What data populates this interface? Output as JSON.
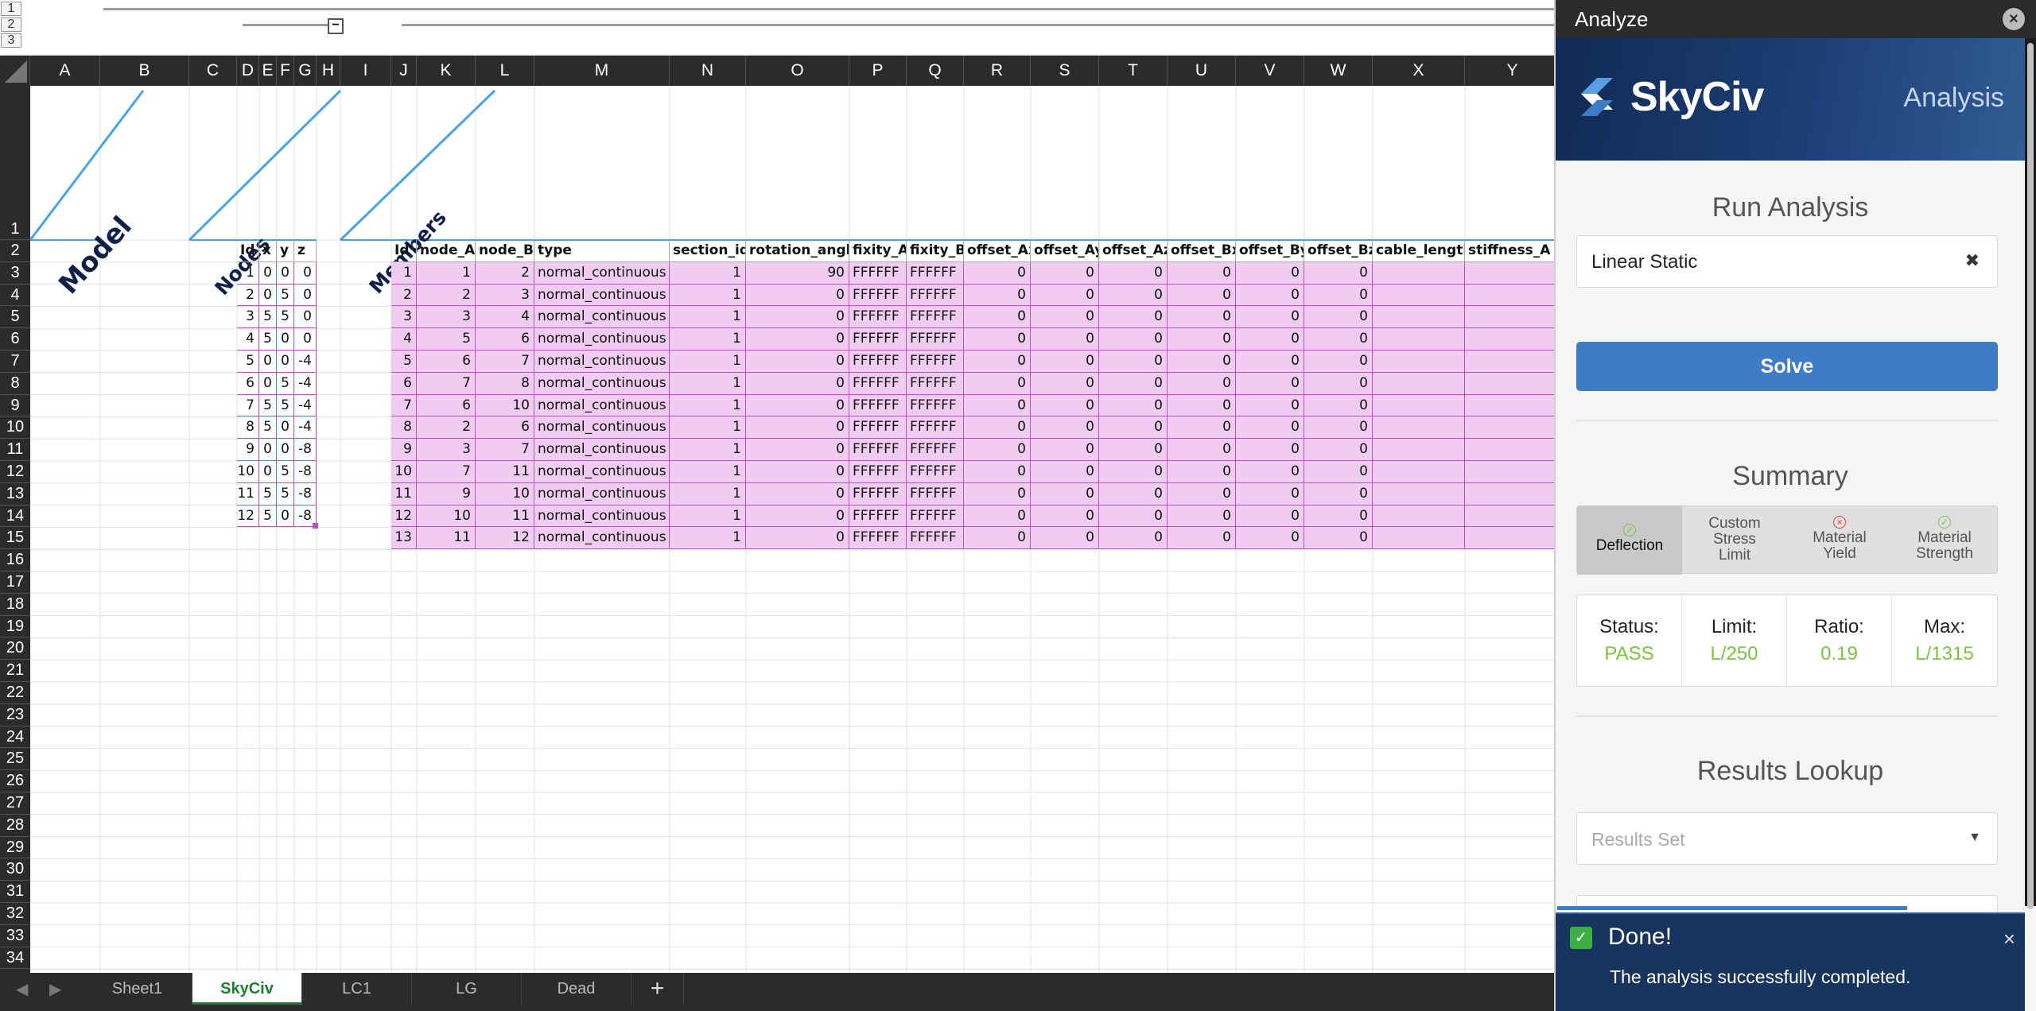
{
  "outline": {
    "levels": [
      "1",
      "2",
      "3"
    ],
    "collapse_symbol": "−"
  },
  "columns": [
    "A",
    "B",
    "C",
    "D",
    "E",
    "F",
    "G",
    "H",
    "I",
    "J",
    "K",
    "L",
    "M",
    "N",
    "O",
    "P",
    "Q",
    "R",
    "S",
    "T",
    "U",
    "V",
    "W",
    "X",
    "Y"
  ],
  "rows": [
    "1",
    "2",
    "3",
    "4",
    "5",
    "6",
    "7",
    "8",
    "9",
    "10",
    "11",
    "12",
    "13",
    "14",
    "15",
    "16",
    "17",
    "18",
    "19",
    "20",
    "21",
    "22",
    "23",
    "24",
    "25",
    "26",
    "27",
    "28",
    "29",
    "30",
    "31",
    "32",
    "33",
    "34"
  ],
  "section_titles": {
    "model": "Model",
    "nodes": "Nodes",
    "members": "Members"
  },
  "nodes": {
    "headers": [
      "Id",
      "x",
      "y",
      "z"
    ],
    "rows": [
      [
        "1",
        "0",
        "0",
        "0"
      ],
      [
        "2",
        "0",
        "5",
        "0"
      ],
      [
        "3",
        "5",
        "5",
        "0"
      ],
      [
        "4",
        "5",
        "0",
        "0"
      ],
      [
        "5",
        "0",
        "0",
        "-4"
      ],
      [
        "6",
        "0",
        "5",
        "-4"
      ],
      [
        "7",
        "5",
        "5",
        "-4"
      ],
      [
        "8",
        "5",
        "0",
        "-4"
      ],
      [
        "9",
        "0",
        "0",
        "-8"
      ],
      [
        "10",
        "0",
        "5",
        "-8"
      ],
      [
        "11",
        "5",
        "5",
        "-8"
      ],
      [
        "12",
        "5",
        "0",
        "-8"
      ]
    ]
  },
  "members": {
    "headers": [
      "Id",
      "node_A",
      "node_B",
      "type",
      "section_id",
      "rotation_angle",
      "fixity_A",
      "fixity_B",
      "offset_Ax",
      "offset_Ay",
      "offset_Az",
      "offset_Bx",
      "offset_By",
      "offset_Bz",
      "cable_length",
      "stiffness_A"
    ],
    "rows": [
      [
        "1",
        "1",
        "2",
        "normal_continuous",
        "1",
        "90",
        "FFFFFF",
        "FFFFFF",
        "0",
        "0",
        "0",
        "0",
        "0",
        "0",
        "",
        ""
      ],
      [
        "2",
        "2",
        "3",
        "normal_continuous",
        "1",
        "0",
        "FFFFFF",
        "FFFFFF",
        "0",
        "0",
        "0",
        "0",
        "0",
        "0",
        "",
        ""
      ],
      [
        "3",
        "3",
        "4",
        "normal_continuous",
        "1",
        "0",
        "FFFFFF",
        "FFFFFF",
        "0",
        "0",
        "0",
        "0",
        "0",
        "0",
        "",
        ""
      ],
      [
        "4",
        "5",
        "6",
        "normal_continuous",
        "1",
        "0",
        "FFFFFF",
        "FFFFFF",
        "0",
        "0",
        "0",
        "0",
        "0",
        "0",
        "",
        ""
      ],
      [
        "5",
        "6",
        "7",
        "normal_continuous",
        "1",
        "0",
        "FFFFFF",
        "FFFFFF",
        "0",
        "0",
        "0",
        "0",
        "0",
        "0",
        "",
        ""
      ],
      [
        "6",
        "7",
        "8",
        "normal_continuous",
        "1",
        "0",
        "FFFFFF",
        "FFFFFF",
        "0",
        "0",
        "0",
        "0",
        "0",
        "0",
        "",
        ""
      ],
      [
        "7",
        "6",
        "10",
        "normal_continuous",
        "1",
        "0",
        "FFFFFF",
        "FFFFFF",
        "0",
        "0",
        "0",
        "0",
        "0",
        "0",
        "",
        ""
      ],
      [
        "8",
        "2",
        "6",
        "normal_continuous",
        "1",
        "0",
        "FFFFFF",
        "FFFFFF",
        "0",
        "0",
        "0",
        "0",
        "0",
        "0",
        "",
        ""
      ],
      [
        "9",
        "3",
        "7",
        "normal_continuous",
        "1",
        "0",
        "FFFFFF",
        "FFFFFF",
        "0",
        "0",
        "0",
        "0",
        "0",
        "0",
        "",
        ""
      ],
      [
        "10",
        "7",
        "11",
        "normal_continuous",
        "1",
        "0",
        "FFFFFF",
        "FFFFFF",
        "0",
        "0",
        "0",
        "0",
        "0",
        "0",
        "",
        ""
      ],
      [
        "11",
        "9",
        "10",
        "normal_continuous",
        "1",
        "0",
        "FFFFFF",
        "FFFFFF",
        "0",
        "0",
        "0",
        "0",
        "0",
        "0",
        "",
        ""
      ],
      [
        "12",
        "10",
        "11",
        "normal_continuous",
        "1",
        "0",
        "FFFFFF",
        "FFFFFF",
        "0",
        "0",
        "0",
        "0",
        "0",
        "0",
        "",
        ""
      ],
      [
        "13",
        "11",
        "12",
        "normal_continuous",
        "1",
        "0",
        "FFFFFF",
        "FFFFFF",
        "0",
        "0",
        "0",
        "0",
        "0",
        "0",
        "",
        ""
      ]
    ]
  },
  "sheets": {
    "tabs": [
      "Sheet1",
      "SkyCiv",
      "LC1",
      "LG",
      "Dead"
    ],
    "active": "SkyCiv",
    "add_label": "+"
  },
  "panel": {
    "title": "Analyze",
    "brand": "SkyCiv",
    "banner_subtitle": "Analysis",
    "run_analysis": {
      "heading": "Run Analysis",
      "type_value": "Linear Static",
      "clear_symbol": "✖",
      "solve_label": "Solve"
    },
    "summary": {
      "heading": "Summary",
      "tabs": [
        {
          "label": "Deflection",
          "status": "pass"
        },
        {
          "label": "Custom Stress Limit",
          "status": "none"
        },
        {
          "label": "Material Yield",
          "status": "fail"
        },
        {
          "label": "Material Strength",
          "status": "pass"
        }
      ],
      "stats": [
        {
          "key": "Status:",
          "value": "PASS"
        },
        {
          "key": "Limit:",
          "value": "L/250"
        },
        {
          "key": "Ratio:",
          "value": "0.19"
        },
        {
          "key": "Max:",
          "value": "L/1315"
        }
      ]
    },
    "results_lookup": {
      "heading": "Results Lookup",
      "placeholder": "Results Set"
    },
    "toast": {
      "title": "Done!",
      "message": "The analysis successfully completed."
    }
  },
  "colors": {
    "member_fill": "#f0cdf0",
    "member_border": "#c050c0",
    "node_border": "#c050c0",
    "title_line": "#4aa3e0",
    "pass": "#7cc242",
    "fail": "#e04040",
    "accent": "#3e7cc7"
  }
}
